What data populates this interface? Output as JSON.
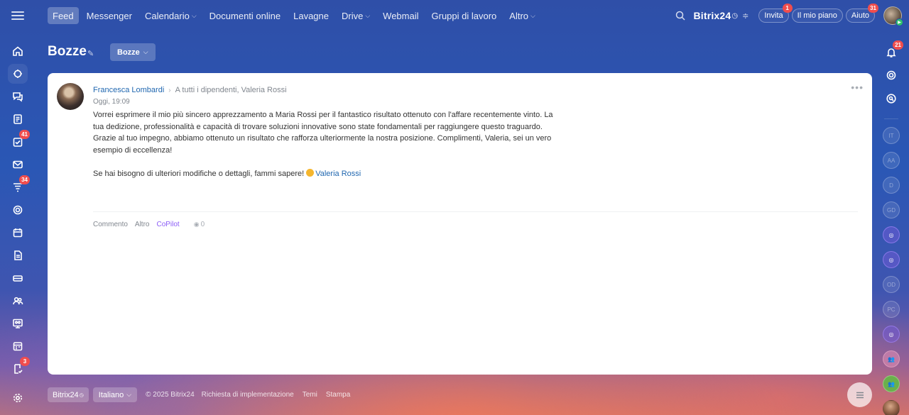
{
  "topnav": {
    "items": [
      {
        "label": "Feed"
      },
      {
        "label": "Messenger"
      },
      {
        "label": "Calendario"
      },
      {
        "label": "Documenti online"
      },
      {
        "label": "Lavagne"
      },
      {
        "label": "Drive"
      },
      {
        "label": "Webmail"
      },
      {
        "label": "Gruppi di lavoro"
      },
      {
        "label": "Altro"
      }
    ],
    "brand": "Bitrix24",
    "invite_label": "Invita",
    "invite_badge": "1",
    "plan_label": "Il mio piano",
    "help_label": "Aiuto",
    "help_badge": "31"
  },
  "left_sidebar": {
    "badges": {
      "tasks": "41",
      "feed": "34",
      "tasks2": "3"
    }
  },
  "page": {
    "title": "Bozze",
    "filter_label": "Bozze"
  },
  "post": {
    "author": "Francesca Lombardi",
    "recipients": "A tutti i dipendenti, Valeria Rossi",
    "time": "Oggi, 19:09",
    "paragraph1": "Vorrei esprimere il mio più sincero apprezzamento a Maria Rossi per il fantastico risultato ottenuto con l'affare recentemente vinto. La tua dedizione, professionalità e capacità di trovare soluzioni innovative sono state fondamentali per raggiungere questo traguardo. Grazie al tuo impegno, abbiamo ottenuto un risultato che rafforza ulteriormente la nostra posizione. Complimenti, Valeria, sei un vero esempio di eccellenza!",
    "paragraph2": "Se hai bisogno di ulteriori modifiche o dettagli, fammi sapere!",
    "mention": "Valeria Rossi",
    "actions": {
      "comment": "Commento",
      "more": "Altro",
      "copilot": "CoPilot",
      "views": "0"
    }
  },
  "right_sidebar": {
    "notifications_badge": "21",
    "chats": [
      "IT",
      "AA",
      "D",
      "GD",
      "",
      "",
      "OD",
      "PC",
      "",
      "",
      "",
      ""
    ]
  },
  "footer": {
    "brand": "Bitrix24",
    "language": "Italiano",
    "copyright": "© 2025 Bitrix24",
    "links": [
      "Richiesta di implementazione",
      "Temi",
      "Stampa"
    ]
  },
  "colors": {
    "accent": "#2067b0",
    "copilot": "#8b5cf6",
    "badge": "#f04d4d"
  }
}
